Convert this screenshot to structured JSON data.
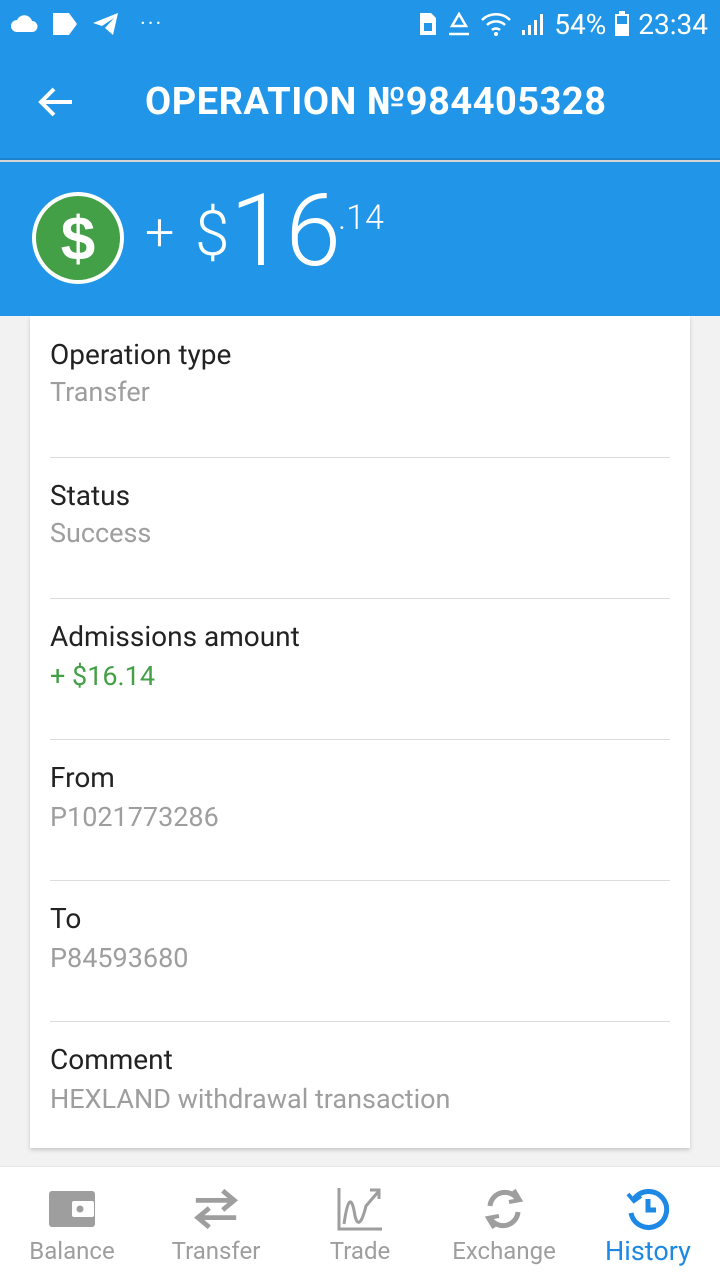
{
  "status_bar": {
    "battery": "54%",
    "time": "23:34",
    "overflow": "···",
    "left_icons": [
      "cloud-icon",
      "tag-icon",
      "telegram-icon"
    ],
    "right_icons": [
      "sim-icon",
      "recycle-icon",
      "wifi-icon",
      "signal-icon",
      "battery-icon"
    ]
  },
  "header": {
    "title": "OPERATION №984405328",
    "back_icon": "arrow-left-icon"
  },
  "amount": {
    "sign": "+",
    "currency": "$",
    "integer": "16",
    "fraction": ".14",
    "icon": "dollar-coin-icon",
    "icon_color": "#43a047"
  },
  "details": [
    {
      "label": "Operation type",
      "value": "Transfer",
      "value_color": "#9e9e9e"
    },
    {
      "label": "Status",
      "value": "Success",
      "value_color": "#9e9e9e"
    },
    {
      "label": "Admissions amount",
      "value": "+ $16.14",
      "value_color": "#43a047"
    },
    {
      "label": "From",
      "value": "P1021773286",
      "value_color": "#9e9e9e"
    },
    {
      "label": "To",
      "value": "P84593680",
      "value_color": "#9e9e9e"
    },
    {
      "label": "Comment",
      "value": "HEXLAND withdrawal transaction",
      "value_color": "#9e9e9e"
    }
  ],
  "bottom_nav": {
    "items": [
      {
        "label": "Balance",
        "icon": "wallet-icon"
      },
      {
        "label": "Transfer",
        "icon": "swap-arrows-icon"
      },
      {
        "label": "Trade",
        "icon": "chart-icon"
      },
      {
        "label": "Exchange",
        "icon": "refresh-icon"
      },
      {
        "label": "History",
        "icon": "history-icon"
      }
    ],
    "active": "History"
  },
  "colors": {
    "primary": "#2196e8",
    "accent_green": "#43a047",
    "nav_active": "#1e88e5"
  }
}
